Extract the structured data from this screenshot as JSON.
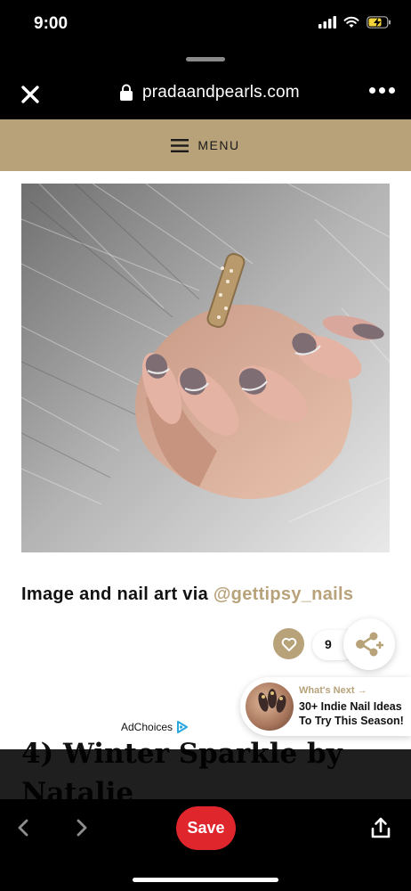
{
  "status": {
    "time": "9:00",
    "battery_color": "#f5d33a"
  },
  "browser": {
    "url": "pradaandpearls.com"
  },
  "site": {
    "menu_label": "MENU",
    "accent_color": "#b8a27a",
    "caption_prefix": "Image and nail art via ",
    "caption_link": "@gettipsy_nails",
    "like_count": "9",
    "whats_next_label": "What's Next →",
    "whats_next_title": "30+ Indie Nail Ideas To Try This Season!",
    "adchoices_label": "AdChoices",
    "heading": "4) Winter Sparkle by Natalie"
  },
  "bottom_bar": {
    "save_label": "Save",
    "save_color": "#e0262d"
  },
  "icons": [
    "signal-icon",
    "wifi-icon",
    "battery-charging-icon",
    "close-icon",
    "lock-icon",
    "more-icon",
    "menu-icon",
    "heart-icon",
    "share-icon",
    "arrow-right-icon",
    "adchoices-icon",
    "back-icon",
    "forward-icon",
    "upload-icon"
  ]
}
